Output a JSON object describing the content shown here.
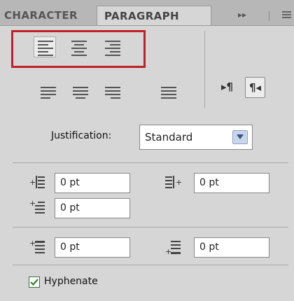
{
  "tabs": {
    "character": "CHARACTER",
    "paragraph": "PARAGRAPH",
    "expand": "▸▸"
  },
  "alignment": {
    "selected": "align-left"
  },
  "direction": {
    "ltr": "▸¶",
    "rtl": "¶◂",
    "active": "rtl"
  },
  "justification": {
    "label": "Justification:",
    "value": "Standard"
  },
  "indents": {
    "left": "0 pt",
    "right": "0 pt",
    "first_line": "0 pt"
  },
  "spacing": {
    "before": "0 pt",
    "after": "0 pt"
  },
  "hyphenate": {
    "label": "Hyphenate",
    "checked": true
  },
  "colors": {
    "highlight": "#c0202a",
    "panel_bg": "#d6d6d6",
    "tab_bar": "#b7b7b7"
  }
}
